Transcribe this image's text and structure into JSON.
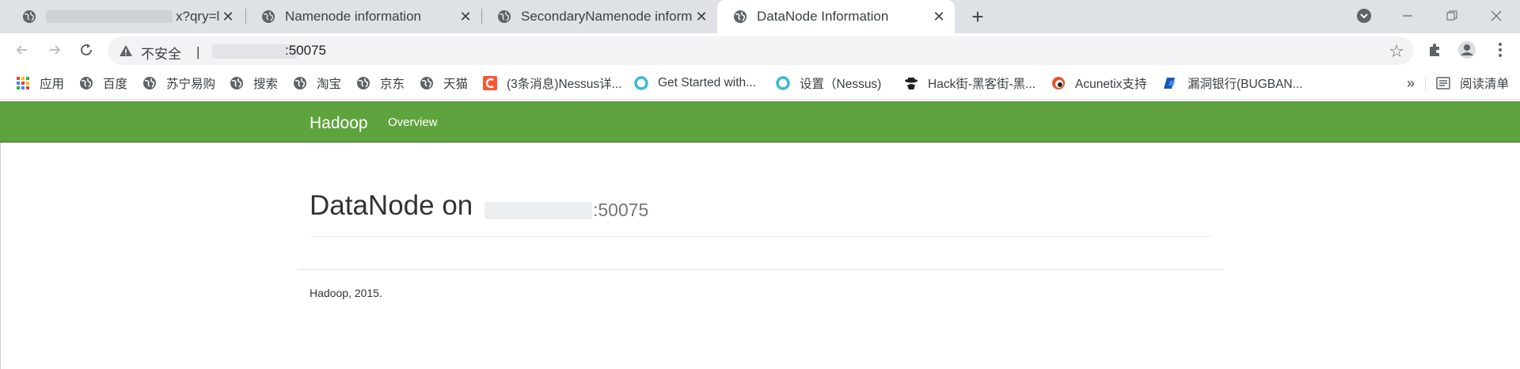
{
  "tabs": [
    {
      "title": "x?qry=l"
    },
    {
      "title": "Namenode information"
    },
    {
      "title": "SecondaryNamenode information"
    },
    {
      "title": "DataNode Information"
    }
  ],
  "address": {
    "security_label": "不安全",
    "separator": "|",
    "port": ":50075"
  },
  "bookmarks": [
    {
      "label": "应用",
      "icon": "apps-grid-icon"
    },
    {
      "label": "百度",
      "icon": "globe-icon"
    },
    {
      "label": "苏宁易购",
      "icon": "globe-icon"
    },
    {
      "label": "搜索",
      "icon": "globe-icon"
    },
    {
      "label": "淘宝",
      "icon": "globe-icon"
    },
    {
      "label": "京东",
      "icon": "globe-icon"
    },
    {
      "label": "天猫",
      "icon": "globe-icon"
    },
    {
      "label": "(3条消息)Nessus详...",
      "icon": "csdn-icon"
    },
    {
      "label": "Get Started with...",
      "icon": "nessus-icon"
    },
    {
      "label": "设置（Nessus)",
      "icon": "nessus-icon"
    },
    {
      "label": "Hack街-黑客街-黑...",
      "icon": "hacker-icon"
    },
    {
      "label": "Acunetix支持",
      "icon": "acunetix-icon"
    },
    {
      "label": "漏洞银行(BUGBAN...",
      "icon": "bugbank-icon"
    }
  ],
  "bookmarks_overflow": "»",
  "reading_list": "阅读清单",
  "hadoop": {
    "brand": "Hadoop",
    "nav_overview": "Overview",
    "title_prefix": "DataNode on",
    "host_port": ":50075",
    "footer": "Hadoop, 2015."
  },
  "colors": {
    "navbar_green": "#5fa33e",
    "tabstrip_bg": "#dee1e6"
  }
}
